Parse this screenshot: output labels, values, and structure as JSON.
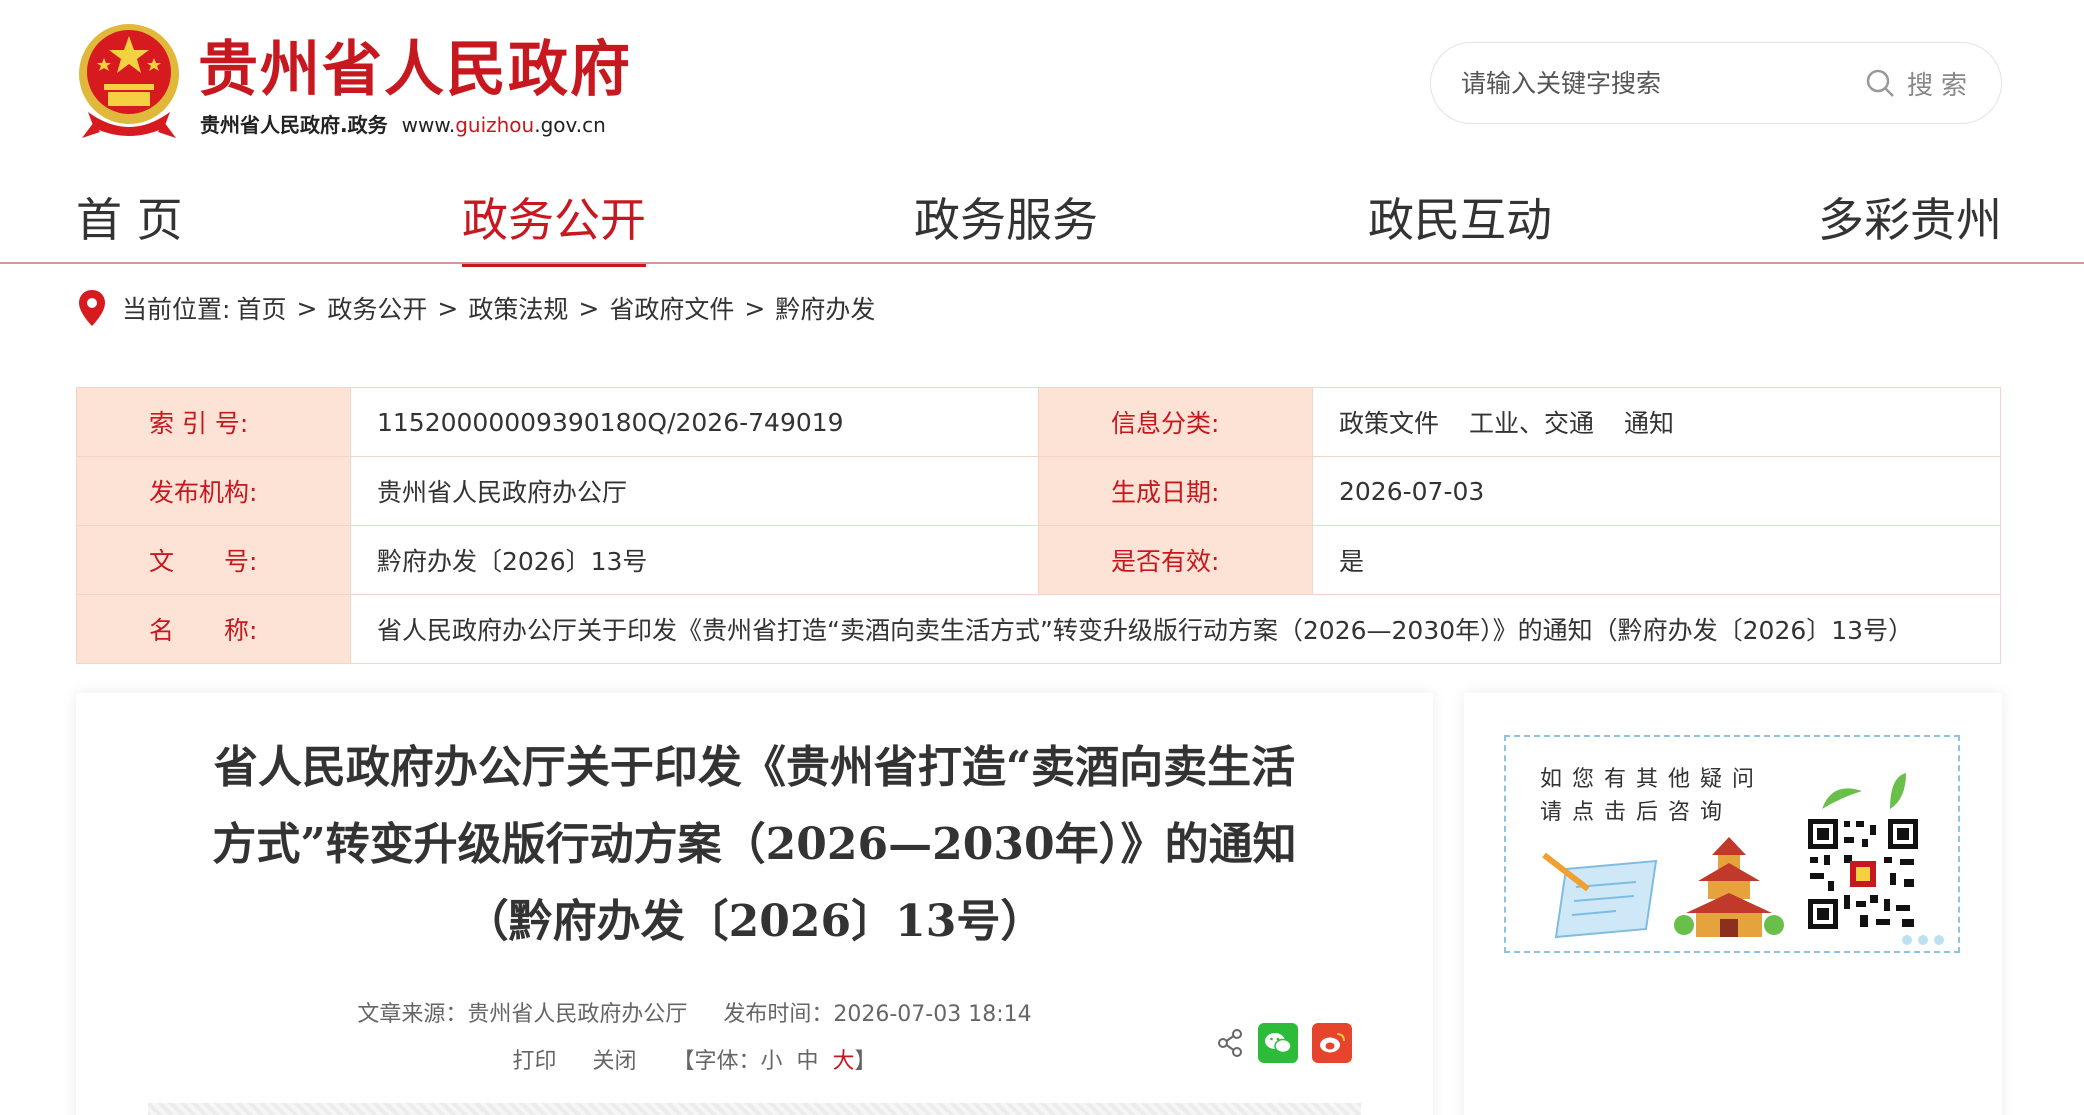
{
  "header": {
    "site_name": "贵州省人民政府",
    "site_sub": "贵州省人民政府.政务",
    "domain_prefix": "www.",
    "domain_brand": "guizhou",
    "domain_suffix": ".gov.cn",
    "search_placeholder": "请输入关键字搜索",
    "search_button": "搜索"
  },
  "nav": {
    "items": [
      {
        "label": "首 页"
      },
      {
        "label": "政务公开"
      },
      {
        "label": "政务服务"
      },
      {
        "label": "政民互动"
      },
      {
        "label": "多彩贵州"
      }
    ],
    "active_index": 1
  },
  "breadcrumb": {
    "prefix": "当前位置:",
    "items": [
      "首页",
      "政务公开",
      "政策法规",
      "省政府文件",
      "黔府办发"
    ],
    "separator": ">"
  },
  "info": {
    "index_label": "索 引 号:",
    "index_value": "11520000009390180Q/2026-749019",
    "category_label": "信息分类:",
    "category_values": [
      "政策文件",
      "工业、交通",
      "通知"
    ],
    "publisher_label": "发布机构:",
    "publisher_value": "贵州省人民政府办公厅",
    "date_label": "生成日期:",
    "date_value": "2026-07-03",
    "docno_label": "文　　号:",
    "docno_value": "黔府办发〔2026〕13号",
    "valid_label": "是否有效:",
    "valid_value": "是",
    "name_label": "名　　称:",
    "name_value": "省人民政府办公厅关于印发《贵州省打造“卖酒向卖生活方式”转变升级版行动方案（2026—2030年）》的通知（黔府办发〔2026〕13号）"
  },
  "article": {
    "title_line1": "省人民政府办公厅关于印发《贵州省打造“卖酒向卖生活",
    "title_line2": "方式”转变升级版行动方案（2026—2030年）》的通知",
    "title_line3": "（黔府办发〔2026〕13号）",
    "source": "文章来源：贵州省人民政府办公厅",
    "time": "发布时间：2026-07-03 18:14",
    "print": "打印",
    "close": "关闭",
    "font_label": "【字体：",
    "font_small": "小",
    "font_medium": "中",
    "font_large": "大",
    "font_end": "】"
  },
  "side": {
    "qa_line1": "如您有其他疑问",
    "qa_line2": "请点击后咨询"
  },
  "colors": {
    "brand_red": "#c7181f",
    "label_bg": "#fde3d5",
    "wechat_green": "#2dbb3a",
    "weibo_red": "#e6442d"
  }
}
